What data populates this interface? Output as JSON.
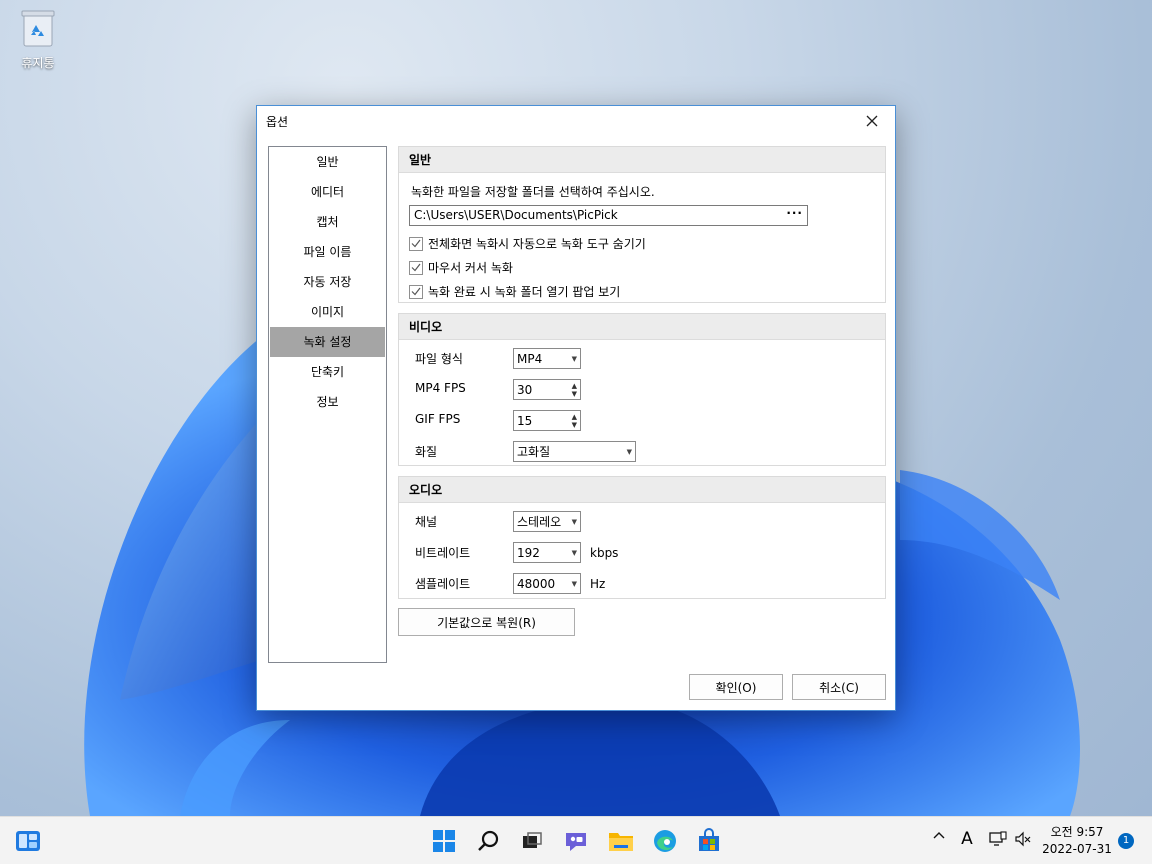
{
  "desktop": {
    "recycle_bin_label": "휴지통"
  },
  "dialog": {
    "title": "옵션",
    "nav": [
      "일반",
      "에디터",
      "캡처",
      "파일 이름",
      "자동 저장",
      "이미지",
      "녹화 설정",
      "단축키",
      "정보"
    ],
    "active_nav": "녹화 설정",
    "general": {
      "heading": "일반",
      "description": "녹화한 파일을 저장할 폴더를 선택하여 주십시오.",
      "path": "C:\\Users\\USER\\Documents\\PicPick",
      "browse_label": "···",
      "checks": [
        {
          "label": "전체화면 녹화시 자동으로 녹화 도구 숨기기",
          "checked": true
        },
        {
          "label": "마우서 커서 녹화",
          "checked": true
        },
        {
          "label": "녹화 완료 시 녹화 폴더 열기 팝업 보기",
          "checked": true
        }
      ]
    },
    "video": {
      "heading": "비디오",
      "file_format_label": "파일 형식",
      "file_format_value": "MP4",
      "mp4_fps_label": "MP4 FPS",
      "mp4_fps_value": "30",
      "gif_fps_label": "GIF FPS",
      "gif_fps_value": "15",
      "quality_label": "화질",
      "quality_value": "고화질"
    },
    "audio": {
      "heading": "오디오",
      "channel_label": "채널",
      "channel_value": "스테레오",
      "bitrate_label": "비트레이트",
      "bitrate_value": "192",
      "bitrate_unit": "kbps",
      "samplerate_label": "샘플레이트",
      "samplerate_value": "48000",
      "samplerate_unit": "Hz"
    },
    "reset_button": "기본값으로 복원(R)",
    "ok_button": "확인(O)",
    "cancel_button": "취소(C)"
  },
  "taskbar": {
    "tray_font_label": "A",
    "clock_time": "오전 9:57",
    "clock_date": "2022-07-31",
    "notification_count": "1",
    "icons": [
      "widgets-icon",
      "start-icon",
      "search-icon",
      "task-view-icon",
      "chat-icon",
      "file-explorer-icon",
      "edge-icon",
      "store-icon"
    ]
  },
  "colors": {
    "accent": "#0067c0",
    "dialog_border": "#4a8fd6",
    "nav_active": "#a5a5a5"
  }
}
